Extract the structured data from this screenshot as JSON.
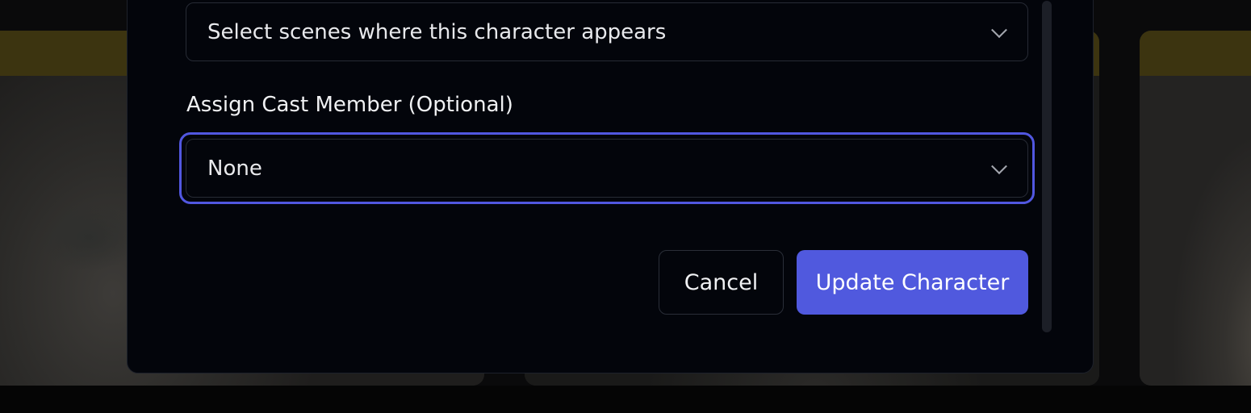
{
  "form": {
    "scenes_placeholder": "Select scenes where this character appears",
    "cast_label": "Assign Cast Member (Optional)",
    "cast_value": "None"
  },
  "actions": {
    "cancel_label": "Cancel",
    "submit_label": "Update Character"
  },
  "colors": {
    "accent": "#5059de",
    "modal_bg": "#03050b",
    "focus_ring": "#5157e0"
  }
}
